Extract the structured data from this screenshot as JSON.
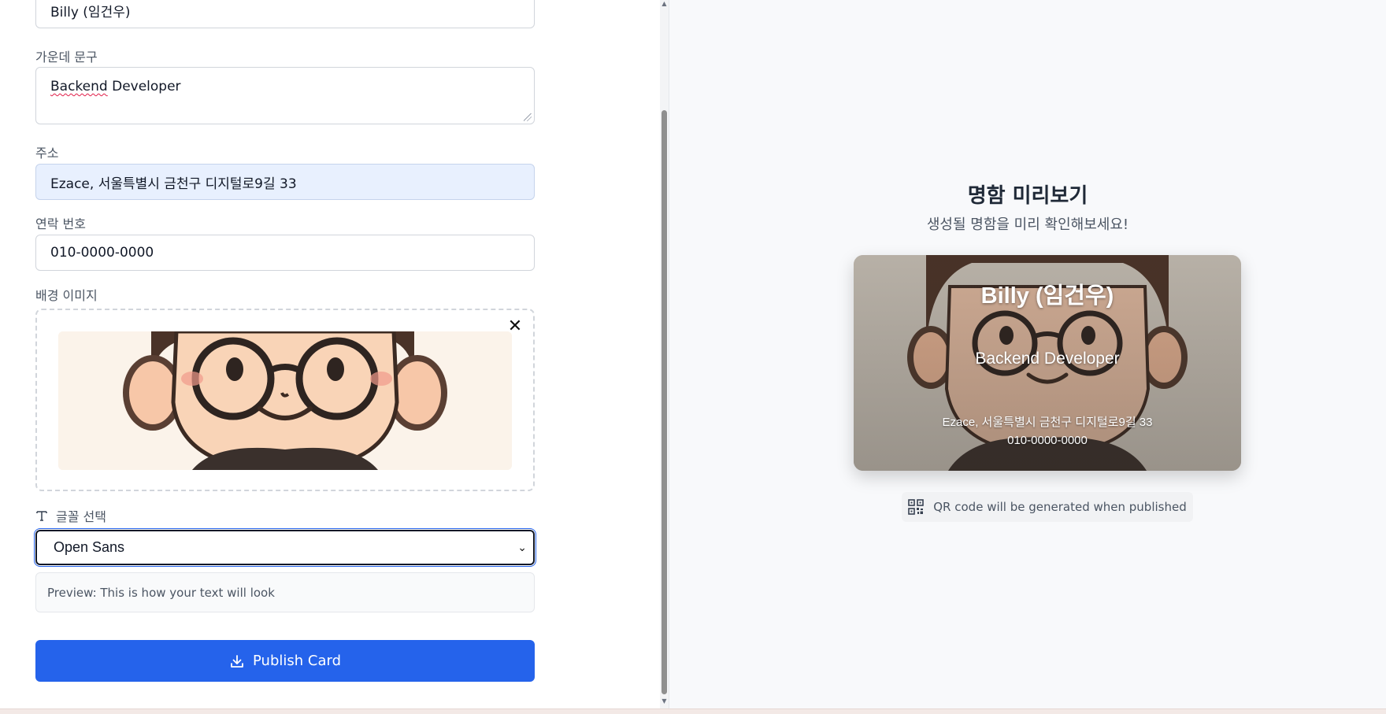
{
  "form": {
    "name_value": "Billy (임건우)",
    "headline_label": "가운데 문구",
    "headline_value_word1": "Backend",
    "headline_value_rest": " Developer",
    "address_label": "주소",
    "address_value": "Ezace, 서울특별시 금천구 디지털로9길 33",
    "phone_label": "연락 번호",
    "phone_value": "010-0000-0000",
    "bg_label": "배경 이미지",
    "remove_symbol": "✕",
    "font_label": "글꼴 선택",
    "font_selected": "Open Sans",
    "font_preview": "Preview: This is how your text will look",
    "publish_label": "Publish Card"
  },
  "preview": {
    "title": "명함 미리보기",
    "subtitle": "생성될 명함을 미리 확인해보세요!",
    "card": {
      "name": "Billy (임건우)",
      "headline": "Backend Developer",
      "address": "Ezace, 서울특별시 금천구 디지털로9길 33",
      "phone": "010-0000-0000"
    },
    "qr_note": "QR code will be generated when published"
  },
  "icons": {
    "font": "type-icon",
    "publish": "download-icon",
    "qr": "qr-code-icon",
    "remove": "close-icon"
  },
  "colors": {
    "primary": "#2563eb",
    "autofill_bg": "#e8f0fe",
    "panel_bg": "#f8f9fb"
  }
}
